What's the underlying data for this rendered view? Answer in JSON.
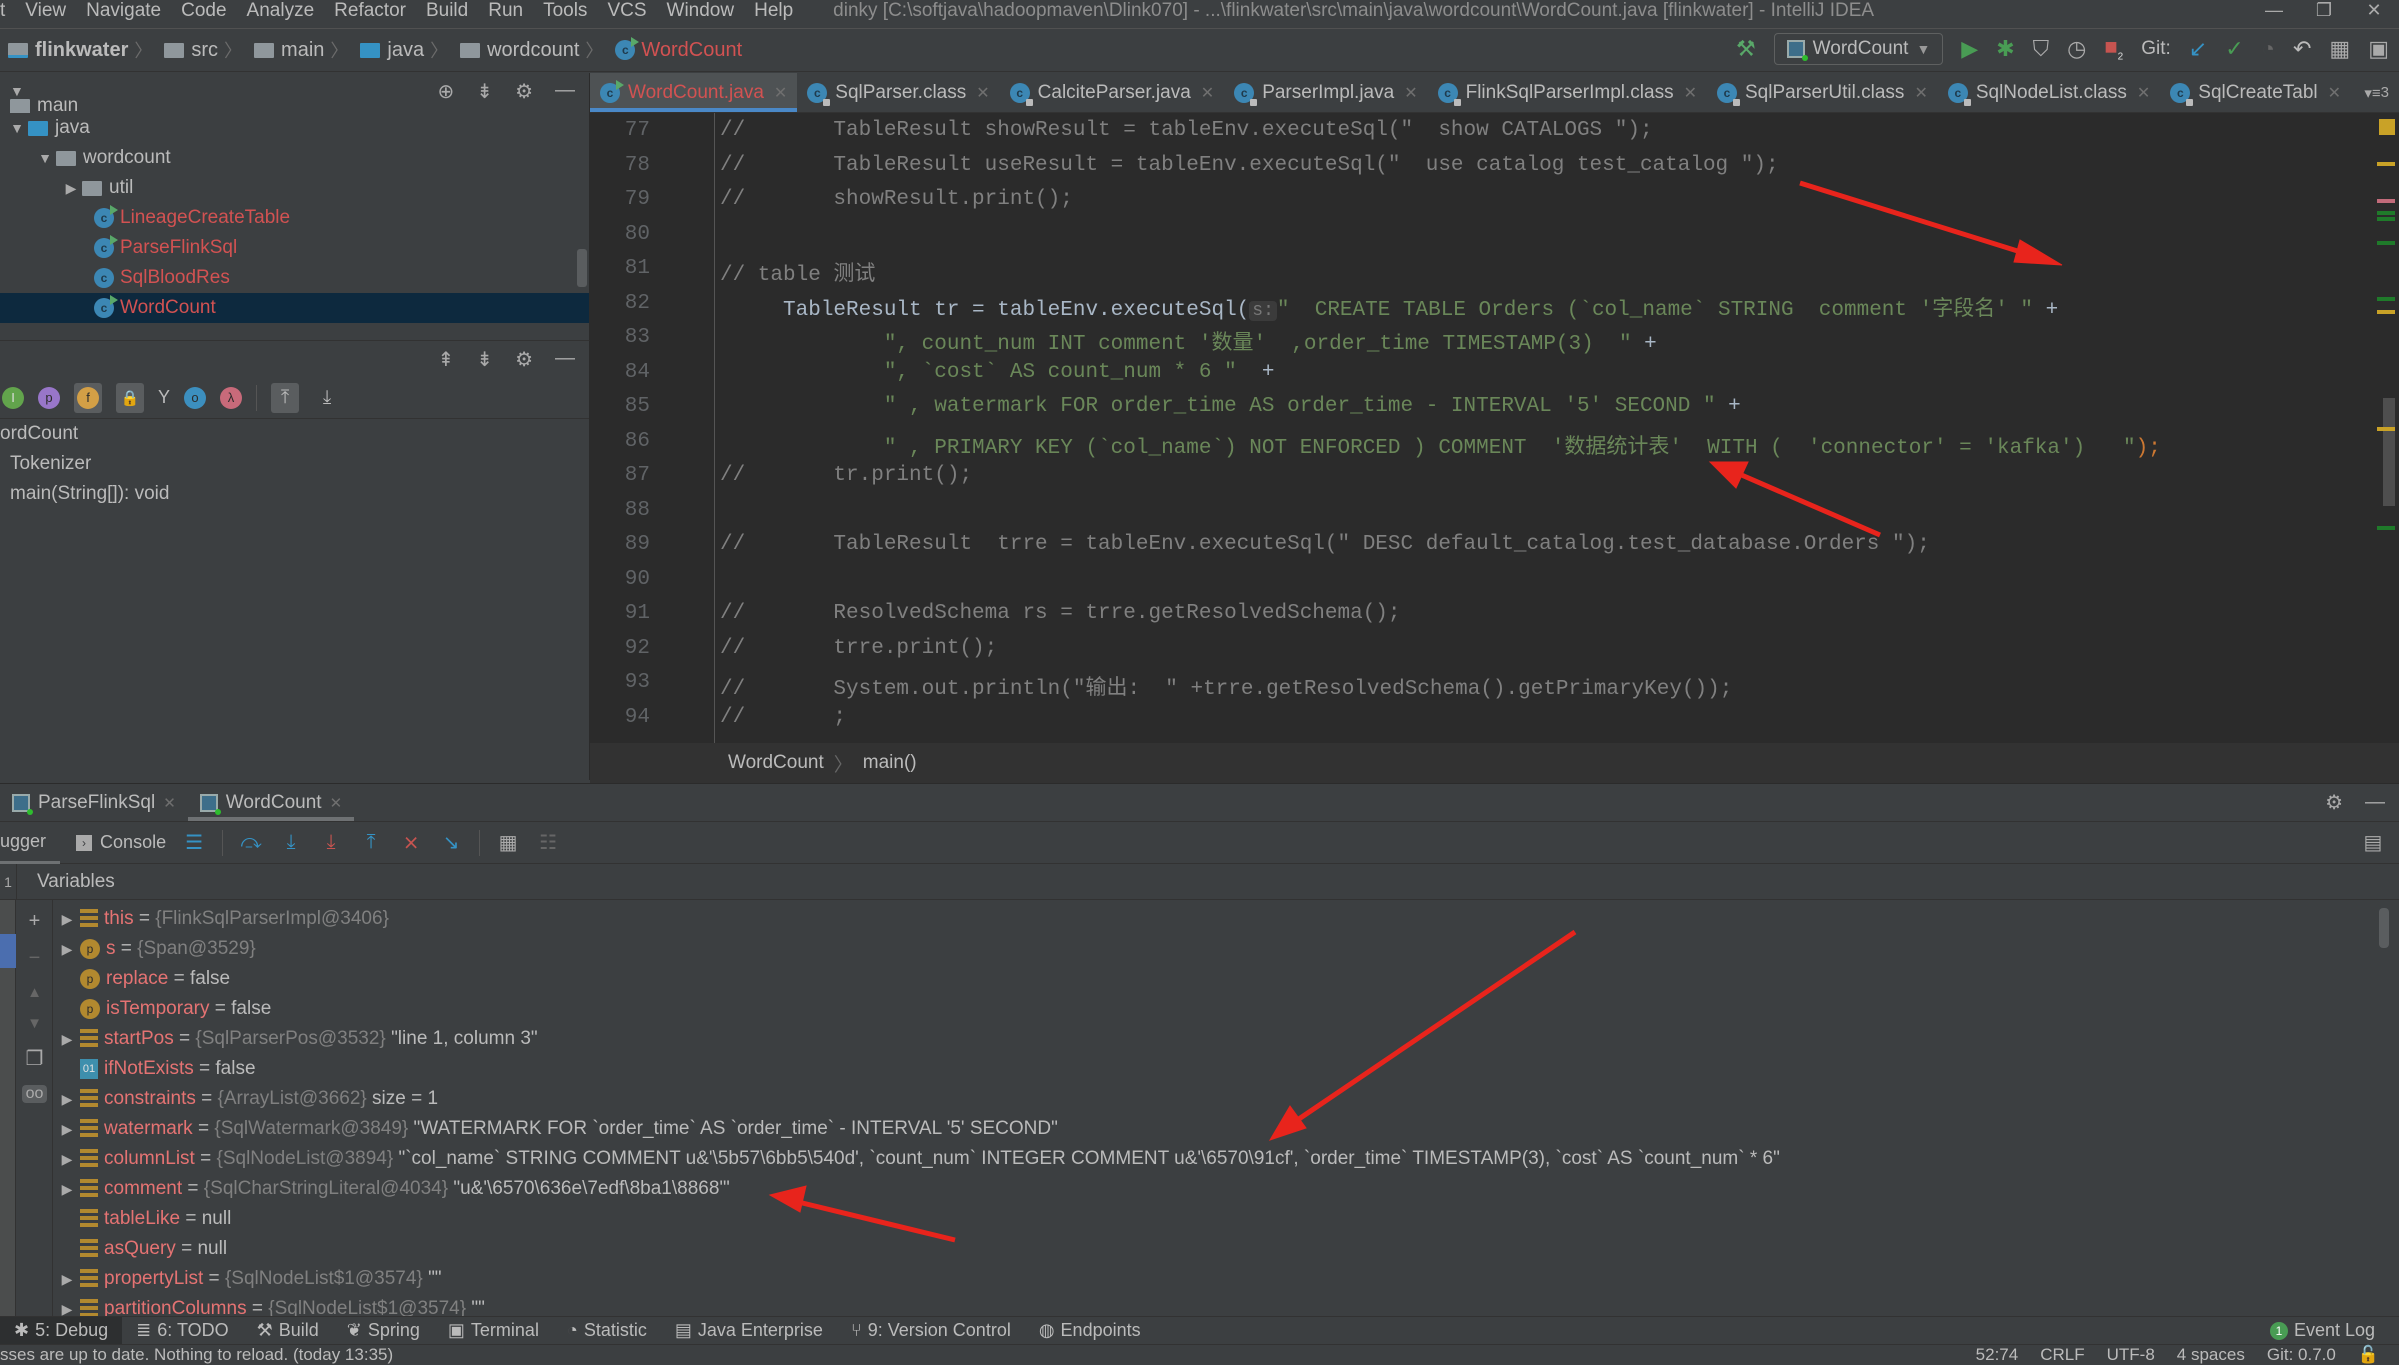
{
  "menubar": {
    "items": [
      "t",
      "View",
      "Navigate",
      "Code",
      "Analyze",
      "Refactor",
      "Build",
      "Run",
      "Tools",
      "VCS",
      "Window",
      "Help"
    ],
    "window_title": "dinky [C:\\softjava\\hadoopmaven\\Dlink070] - ...\\flinkwater\\src\\main\\java\\wordcount\\WordCount.java [flinkwater] - IntelliJ IDEA"
  },
  "navbar": {
    "breadcrumbs": [
      "flinkwater",
      "src",
      "main",
      "java",
      "wordcount",
      "WordCount"
    ],
    "run_config": "WordCount",
    "git_label": "Git:",
    "stop_badge": "2"
  },
  "project": {
    "items": [
      {
        "label": "main",
        "kind": "folder"
      },
      {
        "label": "java",
        "kind": "source-folder"
      },
      {
        "label": "wordcount",
        "kind": "package"
      },
      {
        "label": "util",
        "kind": "package"
      },
      {
        "label": "LineageCreateTable",
        "kind": "class"
      },
      {
        "label": "ParseFlinkSql",
        "kind": "class"
      },
      {
        "label": "SqlBloodRes",
        "kind": "class"
      },
      {
        "label": "WordCount",
        "kind": "class",
        "selected": true
      }
    ]
  },
  "structure": {
    "filters": [
      "I",
      "p",
      "f",
      "lock",
      "Y",
      "o",
      "λ"
    ],
    "items": [
      "ordCount",
      "Tokenizer",
      "main(String[]): void"
    ]
  },
  "editor": {
    "tabs": [
      {
        "label": "WordCount.java",
        "active": true
      },
      {
        "label": "SqlParser.class"
      },
      {
        "label": "CalciteParser.java"
      },
      {
        "label": "ParserImpl.java"
      },
      {
        "label": "FlinkSqlParserImpl.class"
      },
      {
        "label": "SqlParserUtil.class"
      },
      {
        "label": "SqlNodeList.class"
      },
      {
        "label": "SqlCreateTabl"
      }
    ],
    "more_tabs": "3",
    "lines": [
      {
        "n": "77",
        "text": "//       TableResult showResult = tableEnv.executeSql(\"  show CATALOGS \");"
      },
      {
        "n": "78",
        "text": "//       TableResult useResult = tableEnv.executeSql(\"  use catalog test_catalog \");"
      },
      {
        "n": "79",
        "text": "//       showResult.print();"
      },
      {
        "n": "80",
        "text": ""
      },
      {
        "n": "81",
        "text": "// table 测试"
      },
      {
        "n": "82",
        "pre": "     TableResult tr = tableEnv.executeSql(",
        "hint": "s:",
        "str": "\"  CREATE TABLE Orders (`col_name` STRING  comment '字段名' \"",
        "post": " +"
      },
      {
        "n": "83",
        "pre": "             ",
        "str": "\", count_num INT comment '数量'  ,order_time TIMESTAMP(3)  \"",
        "post": " +"
      },
      {
        "n": "84",
        "pre": "             ",
        "str": "\", `cost` AS count_num * 6 \"",
        "post": "  +"
      },
      {
        "n": "85",
        "pre": "             ",
        "str": "\" , watermark FOR order_time AS order_time - INTERVAL '5' SECOND \"",
        "post": " +"
      },
      {
        "n": "86",
        "pre": "             ",
        "str": "\" , PRIMARY KEY (`col_name`) NOT ENFORCED ) COMMENT  '数据统计表'  WITH (  'connector' = 'kafka')   \"",
        "post": ");"
      },
      {
        "n": "87",
        "text": "//       tr.print();"
      },
      {
        "n": "88",
        "text": ""
      },
      {
        "n": "89",
        "text": "//       TableResult  trre = tableEnv.executeSql(\" DESC default_catalog.test_database.Orders \");"
      },
      {
        "n": "90",
        "text": ""
      },
      {
        "n": "91",
        "text": "//       ResolvedSchema rs = trre.getResolvedSchema();"
      },
      {
        "n": "92",
        "text": "//       trre.print();"
      },
      {
        "n": "93",
        "text": "//       System.out.println(\"输出:  \" +trre.getResolvedSchema().getPrimaryKey());"
      },
      {
        "n": "94",
        "text": "//       ;"
      }
    ],
    "breadcrumb": [
      "WordCount",
      "main()"
    ]
  },
  "debug": {
    "session_tabs": [
      {
        "label": "ParseFlinkSql"
      },
      {
        "label": "WordCount",
        "active": true
      }
    ],
    "view_tabs": [
      "ugger",
      "Console"
    ],
    "frames_count": "1",
    "variables_title": "Variables",
    "variables": [
      {
        "icon": "field",
        "expandable": true,
        "name": "this",
        "type": "{FlinkSqlParserImpl@3406}",
        "value": ""
      },
      {
        "icon": "param",
        "expandable": true,
        "name": "s",
        "type": "{Span@3529}",
        "value": ""
      },
      {
        "icon": "param",
        "expandable": false,
        "name": "replace",
        "type": "",
        "value": "false"
      },
      {
        "icon": "param",
        "expandable": false,
        "name": "isTemporary",
        "type": "",
        "value": "false"
      },
      {
        "icon": "field",
        "expandable": true,
        "name": "startPos",
        "type": "{SqlParserPos@3532}",
        "value": "\"line 1, column 3\""
      },
      {
        "icon": "bool",
        "expandable": false,
        "name": "ifNotExists",
        "type": "",
        "value": "false"
      },
      {
        "icon": "field",
        "expandable": true,
        "name": "constraints",
        "type": "{ArrayList@3662}",
        "value": " size = 1"
      },
      {
        "icon": "field",
        "expandable": true,
        "name": "watermark",
        "type": "{SqlWatermark@3849}",
        "value": "\"WATERMARK FOR `order_time` AS `order_time` - INTERVAL '5' SECOND\""
      },
      {
        "icon": "field",
        "expandable": true,
        "name": "columnList",
        "type": "{SqlNodeList@3894}",
        "value": "\"`col_name` STRING COMMENT u&'\\5b57\\6bb5\\540d', `count_num` INTEGER COMMENT u&'\\6570\\91cf', `order_time` TIMESTAMP(3), `cost` AS `count_num` * 6\""
      },
      {
        "icon": "field",
        "expandable": true,
        "name": "comment",
        "type": "{SqlCharStringLiteral@4034}",
        "value": "\"u&'\\6570\\636e\\7edf\\8ba1\\8868'\""
      },
      {
        "icon": "field",
        "expandable": false,
        "name": "tableLike",
        "type": "",
        "value": "null"
      },
      {
        "icon": "field",
        "expandable": false,
        "name": "asQuery",
        "type": "",
        "value": "null"
      },
      {
        "icon": "field",
        "expandable": true,
        "name": "propertyList",
        "type": "{SqlNodeList$1@3574}",
        "value": "\"\""
      },
      {
        "icon": "field",
        "expandable": true,
        "name": "partitionColumns",
        "type": "{SqlNodeList$1@3574}",
        "value": "\"\""
      }
    ]
  },
  "toolstrip": {
    "items": [
      "5: Debug",
      "6: TODO",
      "Build",
      "Spring",
      "Terminal",
      "Statistic",
      "Java Enterprise",
      "9: Version Control",
      "Endpoints"
    ],
    "event_log": "Event Log",
    "event_count": "1"
  },
  "statusbar": {
    "message": "sses are up to date. Nothing to reload. (today 13:35)",
    "position": "52:74",
    "line_sep": "CRLF",
    "encoding": "UTF-8",
    "indent": "4 spaces",
    "git": "Git: 0.7.0"
  },
  "colors": {
    "accent_red_arrow": "#e8241c",
    "modified_file": "#d25252",
    "string": "#6a8759",
    "keyword": "#cc7832",
    "comment": "#808080"
  }
}
